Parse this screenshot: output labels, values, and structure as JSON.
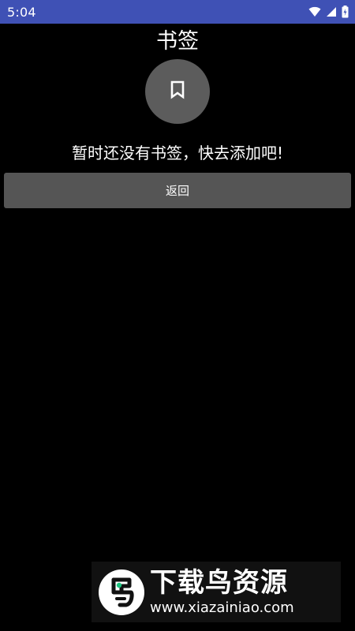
{
  "status_bar": {
    "time": "5:04",
    "background": "#3f51b5",
    "icons": [
      "wifi-icon",
      "signal-icon",
      "battery-icon"
    ]
  },
  "page": {
    "title": "书签",
    "icon": "bookmark-icon",
    "empty_message": "暂时还没有书签，快去添加吧!",
    "back_label": "返回"
  },
  "watermark": {
    "title": "下载鸟资源",
    "url": "www.xiazainiao.com"
  },
  "colors": {
    "background": "#000000",
    "circle": "#5c5c5c",
    "button": "#555555",
    "accent_green": "#19c37d"
  }
}
